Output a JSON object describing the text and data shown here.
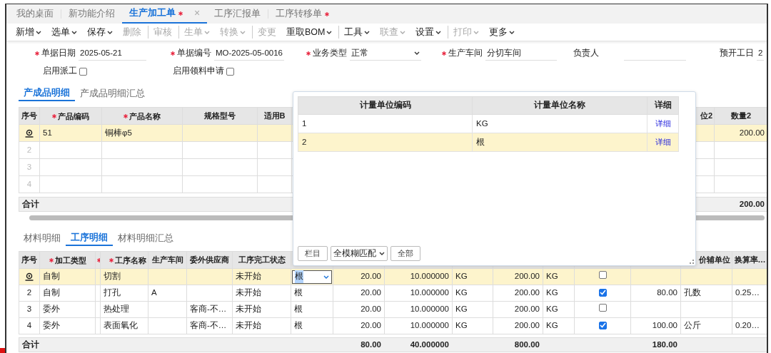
{
  "tabs": [
    {
      "label": "我的桌面",
      "selected": false,
      "modified": false
    },
    {
      "label": "新功能介绍",
      "selected": false,
      "modified": false
    },
    {
      "label": "生产加工单",
      "selected": true,
      "modified": true,
      "close": "×"
    },
    {
      "label": "工序汇报单",
      "selected": false,
      "modified": false
    },
    {
      "label": "工序转移单",
      "selected": false,
      "modified": true
    }
  ],
  "toolbar": [
    {
      "label": "新增",
      "dropdown": true,
      "disabled": false,
      "separator_before": false
    },
    {
      "label": "选单",
      "dropdown": true,
      "disabled": false,
      "separator_before": false
    },
    {
      "label": "保存",
      "dropdown": true,
      "disabled": false,
      "separator_before": false
    },
    {
      "label": "删除",
      "dropdown": false,
      "disabled": true,
      "separator_before": false
    },
    {
      "label": "审核",
      "dropdown": false,
      "disabled": true,
      "separator_before": true
    },
    {
      "label": "生单",
      "dropdown": true,
      "disabled": true,
      "separator_before": true
    },
    {
      "label": "转换",
      "dropdown": true,
      "disabled": true,
      "separator_before": false
    },
    {
      "label": "变更",
      "dropdown": false,
      "disabled": true,
      "separator_before": true
    },
    {
      "label": "重取BOM",
      "dropdown": true,
      "disabled": false,
      "separator_before": false
    },
    {
      "label": "工具",
      "dropdown": true,
      "disabled": false,
      "separator_before": true
    },
    {
      "label": "联查",
      "dropdown": true,
      "disabled": true,
      "separator_before": false
    },
    {
      "label": "设置",
      "dropdown": true,
      "disabled": false,
      "separator_before": false
    },
    {
      "label": "打印",
      "dropdown": true,
      "disabled": true,
      "separator_before": true
    },
    {
      "label": "更多",
      "dropdown": true,
      "disabled": false,
      "separator_before": false
    }
  ],
  "form": {
    "fields": [
      {
        "label": "单据日期",
        "value": "2025-05-21",
        "required": true,
        "kind": "text"
      },
      {
        "label": "单据编号",
        "value": "MO-2025-05-0016",
        "required": true,
        "kind": "text"
      },
      {
        "label": "业务类型",
        "value": "正常",
        "required": true,
        "kind": "select"
      },
      {
        "label": "生产车间",
        "value": "分切车间",
        "required": true,
        "kind": "text"
      },
      {
        "label": "负责人",
        "required": false,
        "kind": "text"
      },
      {
        "label": "预开工日",
        "value": "2",
        "required": false,
        "kind": "text"
      }
    ],
    "options": [
      {
        "label": "启用派工",
        "checked": false
      },
      {
        "label": "启用领料申请",
        "checked": false
      }
    ]
  },
  "product_tabs": [
    {
      "label": "产成品明细",
      "selected": true
    },
    {
      "label": "产成品明细汇总",
      "selected": false
    }
  ],
  "product_grid": {
    "columns": [
      {
        "label": "序号",
        "required": false,
        "kind": "seq"
      },
      {
        "label": "产品编码",
        "required": true,
        "kind": "text"
      },
      {
        "label": "产品名称",
        "required": true,
        "kind": "text"
      },
      {
        "label": "规格型号",
        "required": false,
        "kind": "text"
      },
      {
        "label": "适用B",
        "required": false,
        "kind": "text"
      },
      {},
      {
        "label": "位2",
        "required": false,
        "kind": "text"
      },
      {
        "label": "数量2",
        "required": false,
        "kind": "number"
      }
    ],
    "rows": [
      {
        "current": true,
        "blank": false,
        "cells": [
          null,
          "51",
          "铜棒φ5",
          null,
          null,
          null,
          null,
          "200.00"
        ]
      },
      {
        "current": false,
        "blank": true,
        "cells": [
          "2",
          null,
          null,
          null,
          null,
          null,
          null,
          null
        ]
      },
      {
        "current": false,
        "blank": true,
        "cells": [
          "3",
          null,
          null,
          null,
          null,
          null,
          null,
          null
        ]
      },
      {
        "current": false,
        "blank": true,
        "cells": [
          "4",
          null,
          null,
          null,
          null,
          null,
          null,
          null
        ]
      }
    ],
    "total": {
      "cells": [
        "合计",
        null,
        null,
        null,
        null,
        null,
        null,
        "200.00"
      ]
    }
  },
  "process_tabs": [
    {
      "label": "材料明细",
      "selected": false
    },
    {
      "label": "工序明细",
      "selected": true
    },
    {
      "label": "材料明细汇总",
      "selected": false
    }
  ],
  "process_grid": {
    "columns": [
      {
        "label": "序号",
        "required": false,
        "kind": "seq"
      },
      {
        "label": "加工类型",
        "required": true,
        "kind": "text"
      },
      {
        "required": true
      },
      {
        "label": "工序名称",
        "required": true,
        "kind": "text"
      },
      {
        "label": "生产车间",
        "required": false,
        "kind": "text"
      },
      {
        "label": "委外供应商",
        "required": false,
        "kind": "text"
      },
      {
        "label": "工序完工状态",
        "required": false,
        "kind": "text"
      },
      {
        "kind": "text"
      },
      {
        "kind": "number"
      },
      {
        "kind": "number"
      },
      {
        "kind": "text"
      },
      {
        "kind": "number"
      },
      {
        "kind": "text"
      },
      {
        "kind": "check"
      },
      {
        "kind": "number"
      },
      {
        "label": "价辅单位",
        "required": false,
        "kind": "text"
      },
      {
        "label": "换算率…",
        "required": false,
        "kind": "text"
      }
    ],
    "rows": [
      {
        "current": true,
        "blank": false,
        "cells": [
          null,
          "自制",
          null,
          "切割",
          null,
          null,
          "未开始",
          {
            "kind": "select",
            "value": "根"
          },
          "20.00",
          "10.000000",
          "KG",
          "200.00",
          "KG",
          {
            "kind": "check",
            "checked": false
          },
          null,
          null,
          null
        ]
      },
      {
        "current": false,
        "blank": false,
        "cells": [
          "2",
          "自制",
          null,
          "打孔",
          "A",
          null,
          "未开始",
          "根",
          "20.00",
          "10.000000",
          "KG",
          "200.00",
          "KG",
          {
            "kind": "check",
            "checked": true
          },
          "80.00",
          "孔数",
          "0.25…"
        ]
      },
      {
        "current": false,
        "blank": false,
        "cells": [
          "3",
          "委外",
          null,
          "热处理",
          null,
          "客商-不…",
          "未开始",
          "根",
          "20.00",
          "10.000000",
          "KG",
          "200.00",
          "KG",
          {
            "kind": "check",
            "checked": false
          },
          null,
          null,
          null
        ]
      },
      {
        "current": false,
        "blank": false,
        "cells": [
          "4",
          "委外",
          null,
          "表面氧化",
          null,
          "客商-不…",
          "未开始",
          "根",
          "20.00",
          "10.000000",
          "KG",
          "200.00",
          "KG",
          {
            "kind": "check",
            "checked": true
          },
          "100.00",
          "公斤",
          "0.20…"
        ]
      }
    ],
    "total": {
      "cells": [
        "合计",
        null,
        null,
        null,
        null,
        null,
        null,
        null,
        "80.00",
        "40.000000",
        null,
        "800.00",
        null,
        null,
        "180.00",
        null,
        null
      ]
    }
  },
  "unit_popup": {
    "columns": [
      {
        "label": "计量单位编码"
      },
      {
        "label": "计量单位名称"
      },
      {
        "label": "详细"
      }
    ],
    "rows": [
      {
        "cells": [
          "1",
          "KG"
        ],
        "link": "详细",
        "selected": false
      },
      {
        "cells": [
          "2",
          "根"
        ],
        "link": "详细",
        "selected": true
      }
    ],
    "footer": [
      {
        "kind": "button",
        "label": "栏目"
      },
      {
        "kind": "select",
        "value": "全模糊匹配"
      },
      {
        "kind": "button",
        "label": "全部"
      }
    ]
  }
}
